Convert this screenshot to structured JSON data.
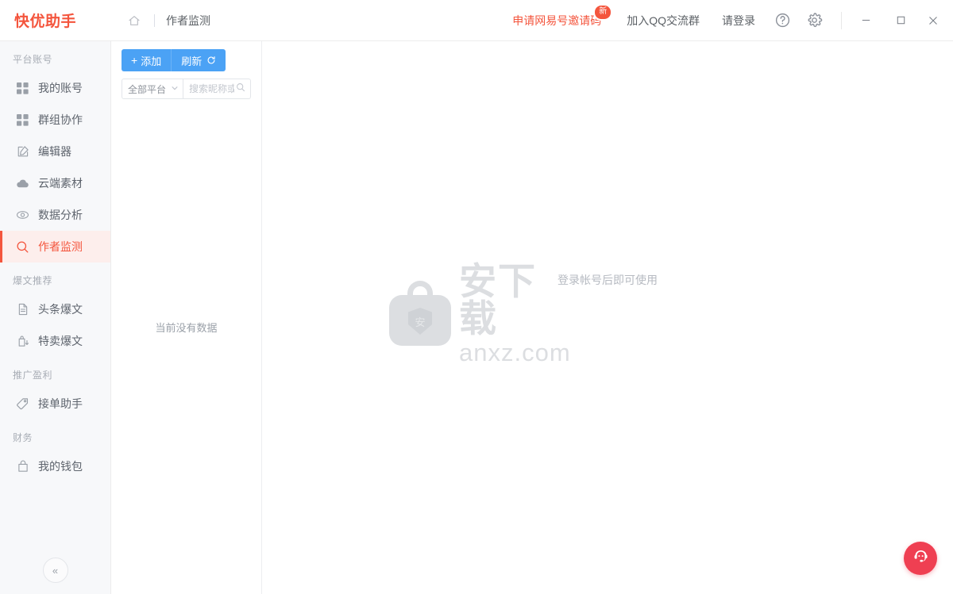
{
  "app": {
    "brand": "快优助手",
    "breadcrumb": "作者监测"
  },
  "titlebar": {
    "home_icon": "home-icon",
    "links": [
      {
        "label": "申请网易号邀请码",
        "badge": "新",
        "accent": true
      },
      {
        "label": "加入QQ交流群",
        "badge": "",
        "accent": false
      },
      {
        "label": "请登录",
        "badge": "",
        "accent": false
      }
    ],
    "help_icon": "help-circle-icon",
    "settings_icon": "gear-icon",
    "window": {
      "minimize": "minimize-icon",
      "maximize": "maximize-icon",
      "close": "close-icon"
    }
  },
  "sidebar": {
    "groups": [
      {
        "title": "平台账号",
        "items": [
          {
            "label": "我的账号",
            "icon": "grid-icon",
            "active": false
          },
          {
            "label": "群组协作",
            "icon": "grid-icon",
            "active": false
          },
          {
            "label": "编辑器",
            "icon": "edit-square-icon",
            "active": false
          },
          {
            "label": "云端素材",
            "icon": "cloud-icon",
            "active": false
          },
          {
            "label": "数据分析",
            "icon": "eye-icon",
            "active": false
          },
          {
            "label": "作者监测",
            "icon": "search-icon",
            "active": true
          }
        ]
      },
      {
        "title": "爆文推荐",
        "items": [
          {
            "label": "头条爆文",
            "icon": "document-icon",
            "active": false
          },
          {
            "label": "特卖爆文",
            "icon": "bag-download-icon",
            "active": false
          }
        ]
      },
      {
        "title": "推广盈利",
        "items": [
          {
            "label": "接单助手",
            "icon": "tag-icon",
            "active": false
          }
        ]
      },
      {
        "title": "财务",
        "items": [
          {
            "label": "我的钱包",
            "icon": "wallet-icon",
            "active": false
          }
        ]
      }
    ],
    "collapse_label": "«"
  },
  "list_panel": {
    "add_label": "添加",
    "add_icon": "plus-icon",
    "refresh_label": "刷新",
    "refresh_icon": "refresh-icon",
    "platform_filter": "全部平台",
    "platform_chevron": "chevron-down-icon",
    "search_value": "",
    "search_placeholder": "搜索昵称或ID",
    "search_icon": "search-icon",
    "empty_text": "当前没有数据"
  },
  "main": {
    "hint": "登录帐号后即可使用",
    "watermark": {
      "cn": "安下载",
      "en": "anxz.com",
      "shield_char": "安"
    },
    "support_icon": "headset-support-icon"
  },
  "colors": {
    "brand_red": "#f4553d",
    "accent_blue": "#4ba2f5",
    "fab_red": "#ef3f52",
    "sidebar_bg": "#f7f8fa",
    "active_bg": "#fdeeec"
  }
}
